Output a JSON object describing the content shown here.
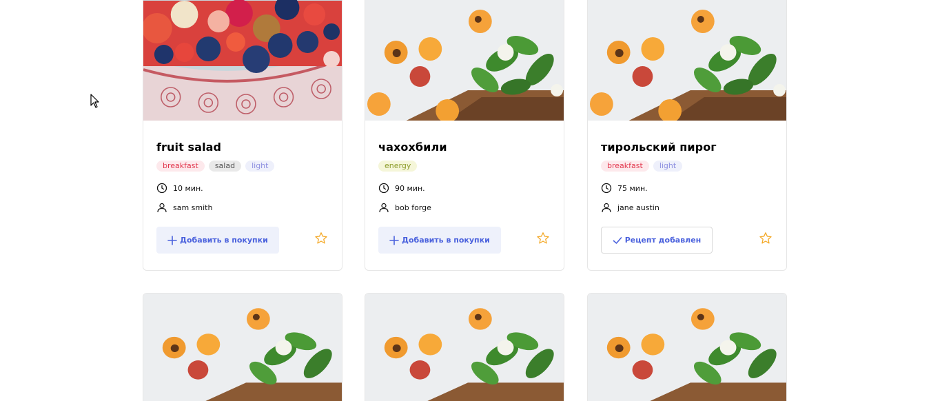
{
  "cards": [
    {
      "title": "fruit salad",
      "tags": [
        "breakfast",
        "salad",
        "light"
      ],
      "time": "10 мин.",
      "author": "sam smith",
      "button": "Добавить в покупки",
      "button_state": "add",
      "photo": "fruit-salad-photo"
    },
    {
      "title": "чахохбили",
      "tags": [
        "energy"
      ],
      "time": "90 мин.",
      "author": "bob forge",
      "button": "Добавить в покупки",
      "button_state": "add",
      "photo": "apricots-photo"
    },
    {
      "title": "тирольский пирог",
      "tags": [
        "breakfast",
        "light"
      ],
      "time": "75 мин.",
      "author": "jane austin",
      "button": "Рецепт добавлен",
      "button_state": "added",
      "photo": "apricots-photo"
    }
  ],
  "colors": {
    "accent": "#4a61dd",
    "star": "#f4a928",
    "tag_breakfast": "#e2394f",
    "tag_light": "#8d8fe0",
    "tag_energy": "#8c9b2a"
  },
  "icons": {
    "time": "clock-icon",
    "author": "user-icon",
    "add": "plus-icon",
    "added": "check-icon",
    "favorite": "star-icon"
  }
}
